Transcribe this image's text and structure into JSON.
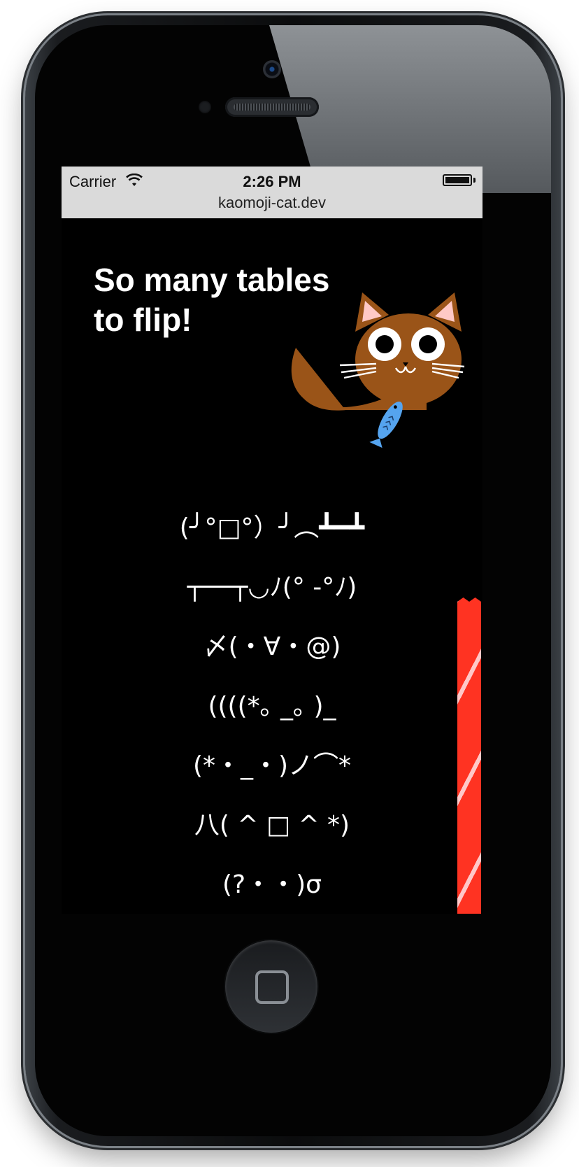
{
  "status_bar": {
    "carrier": "Carrier",
    "time": "2:26 PM",
    "url": "kaomoji-cat.dev"
  },
  "page": {
    "headline_line1": "So many tables",
    "headline_line2": "to flip!",
    "kaomoji": [
      "(╯°□°）╯︵┻━┻",
      "┬──┬◡ﾉ(° -°ﾉ)",
      "〆(・∀・@)",
      "((((*｡ _｡ )_",
      "(*・_・)ノ⌒*",
      "八( ^ □ ^ *)",
      "(?・・)σ"
    ]
  },
  "colors": {
    "screen_background": "#000000",
    "status_bar": "#dadada",
    "cat_fur": "#9a5418",
    "fish": "#55a4ef",
    "ribbon": "#ff3322"
  },
  "icons": [
    "wifi-icon",
    "battery-icon",
    "cat-illustration",
    "fish-icon",
    "home-button-icon"
  ]
}
